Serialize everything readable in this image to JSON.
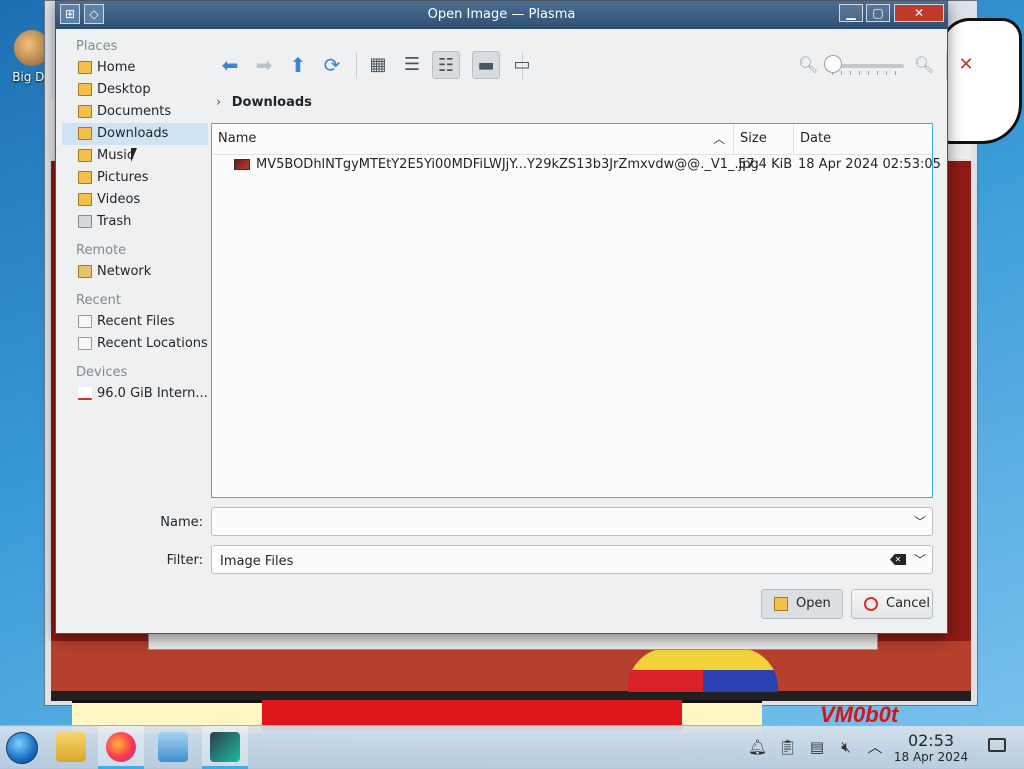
{
  "window": {
    "title": "Open Image — Plasma"
  },
  "desktop": {
    "icon_label": "Big\nDe",
    "watermark": "VM0b0t"
  },
  "places": {
    "sections": [
      {
        "title": "Places",
        "items": [
          {
            "label": "Home",
            "icon": "home-folder-icon"
          },
          {
            "label": "Desktop",
            "icon": "desktop-folder-icon"
          },
          {
            "label": "Documents",
            "icon": "documents-folder-icon"
          },
          {
            "label": "Downloads",
            "icon": "downloads-folder-icon",
            "active": true
          },
          {
            "label": "Music",
            "icon": "music-folder-icon"
          },
          {
            "label": "Pictures",
            "icon": "pictures-folder-icon"
          },
          {
            "label": "Videos",
            "icon": "videos-folder-icon"
          },
          {
            "label": "Trash",
            "icon": "trash-icon"
          }
        ]
      },
      {
        "title": "Remote",
        "items": [
          {
            "label": "Network",
            "icon": "network-folder-icon"
          }
        ]
      },
      {
        "title": "Recent",
        "items": [
          {
            "label": "Recent Files",
            "icon": "recent-files-icon"
          },
          {
            "label": "Recent Locations",
            "icon": "recent-locations-icon"
          }
        ]
      },
      {
        "title": "Devices",
        "items": [
          {
            "label": "96.0 GiB Intern...",
            "icon": "hard-drive-icon"
          }
        ]
      }
    ]
  },
  "toolbar": {
    "buttons": [
      {
        "name": "back",
        "icon": "back-arrow-icon",
        "glyph": "⬅",
        "enabled": true
      },
      {
        "name": "forward",
        "icon": "forward-arrow-icon",
        "glyph": "➡",
        "enabled": false
      },
      {
        "name": "up",
        "icon": "up-arrow-icon",
        "glyph": "⬆",
        "enabled": true
      },
      {
        "name": "reload",
        "icon": "reload-icon",
        "glyph": "⟳",
        "enabled": true
      },
      {
        "name": "icon-view",
        "icon": "icon-view-icon",
        "glyph": "▦",
        "enabled": true
      },
      {
        "name": "compact-view",
        "icon": "compact-view-icon",
        "glyph": "☰",
        "enabled": true
      },
      {
        "name": "detail-view",
        "icon": "detail-view-icon",
        "glyph": "☷",
        "enabled": true,
        "checked": true
      },
      {
        "name": "preview",
        "icon": "preview-icon",
        "glyph": "▬",
        "enabled": true,
        "checked": true
      },
      {
        "name": "panel",
        "icon": "panel-icon",
        "glyph": "▭",
        "enabled": true
      }
    ],
    "zoom_level": 0.0,
    "settings_icon": "options-icon"
  },
  "breadcrumb": {
    "current": "Downloads"
  },
  "file_list": {
    "columns": {
      "name": "Name",
      "size": "Size",
      "date": "Date"
    },
    "sort_column": "Name",
    "sort_order": "ascending",
    "rows": [
      {
        "name": "MV5BODhlNTgyMTEtY2E5Yi00MDFiLWJjY...Y29kZS13b3JrZmxvdw@@._V1_.jpg",
        "size": "57.4 KiB",
        "date": "18 Apr 2024 02:53:05"
      }
    ]
  },
  "form": {
    "name_label": "Name:",
    "name_value": "",
    "filter_label": "Filter:",
    "filter_value": "Image Files"
  },
  "buttons": {
    "open": "Open",
    "cancel": "Cancel"
  },
  "taskbar": {
    "time": "02:53",
    "date": "18 Apr 2024"
  },
  "colors": {
    "accent": "#3daee9",
    "titlebar": "#3a5d80",
    "selection": "#cfe3f4"
  }
}
